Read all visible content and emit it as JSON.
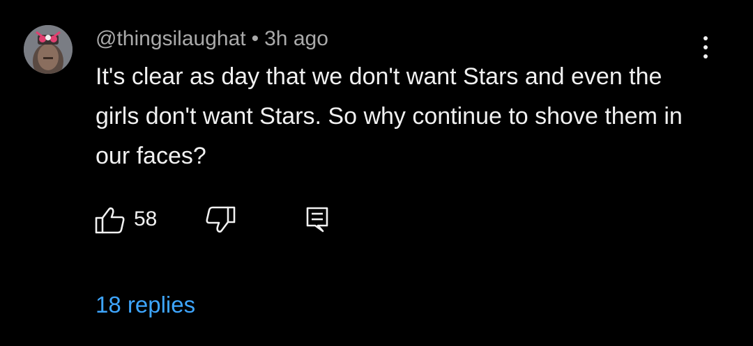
{
  "comment": {
    "author": "@thingsilaughat",
    "separator": "•",
    "timestamp": "3h ago",
    "text": "It's clear as day that we don't want Stars and even the girls don't want Stars. So why continue to shove them in our faces?",
    "like_count": "58",
    "replies_label": "18 replies"
  },
  "icons": {
    "more": "more-vert-icon",
    "like": "thumbs-up-icon",
    "dislike": "thumbs-down-icon",
    "reply": "reply-comment-icon"
  },
  "colors": {
    "background": "#000000",
    "primary_text": "#f1f1f1",
    "secondary_text": "#aaaaaa",
    "link": "#3ea6ff"
  }
}
